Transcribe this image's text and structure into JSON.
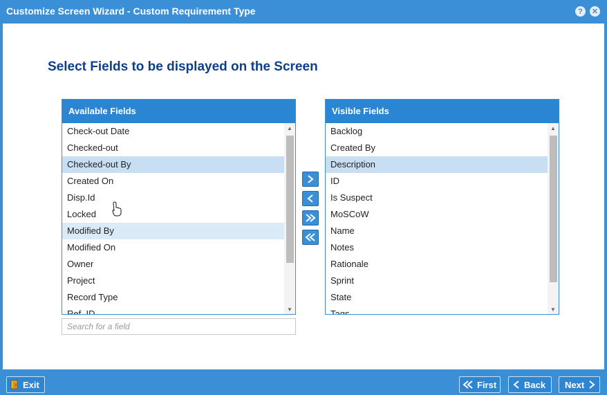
{
  "window": {
    "title": "Customize Screen Wizard - Custom Requirement Type",
    "help_icon": "question-mark-icon",
    "close_icon": "close-icon"
  },
  "heading": "Select Fields to be displayed on the Screen",
  "available": {
    "header": "Available Fields",
    "items": [
      "Check-out Date",
      "Checked-out",
      "Checked-out By",
      "Created On",
      "Disp.Id",
      "Locked",
      "Modified By",
      "Modified On",
      "Owner",
      "Project",
      "Record Type",
      "Ref. ID"
    ],
    "selected": "Checked-out By",
    "hovered": "Modified By"
  },
  "visible": {
    "header": "Visible Fields",
    "items": [
      "Backlog",
      "Created By",
      "Description",
      "ID",
      "Is Suspect",
      "MoSCoW",
      "Name",
      "Notes",
      "Rationale",
      "Sprint",
      "State",
      "Tags"
    ],
    "selected": "Description"
  },
  "search": {
    "placeholder": "Search for a field",
    "value": ""
  },
  "footer": {
    "exit_label": "Exit",
    "first_label": "First",
    "back_label": "Back",
    "next_label": "Next"
  },
  "colors": {
    "accent": "#3a8fd6",
    "header": "#2a86d2",
    "heading": "#0e3f8a",
    "selected_row": "#c7def3"
  }
}
